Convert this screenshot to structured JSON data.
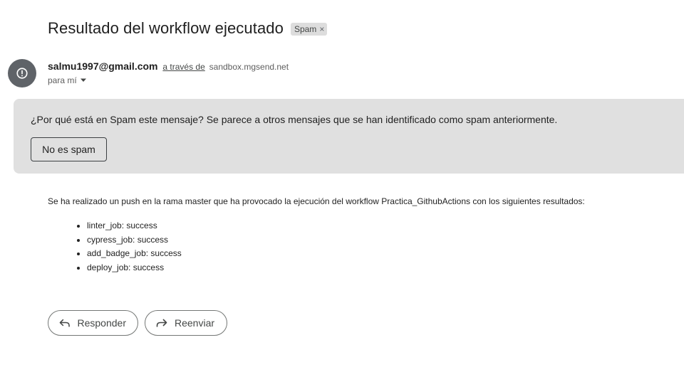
{
  "email": {
    "subject": "Resultado del workflow ejecutado",
    "label": "Spam",
    "label_close": "×",
    "sender_email": "salmu1997@gmail.com",
    "via_text": "a través de",
    "via_domain": "sandbox.mgsend.net",
    "to_text": "para mí",
    "avatar_icon": "alert-circle-icon"
  },
  "spam_banner": {
    "question": "¿Por qué está en Spam este mensaje?",
    "explanation": " Se parece a otros mensajes que se han identificado como spam anteriormente.",
    "not_spam_button": "No es spam",
    "background": "#e0e0e0"
  },
  "body": {
    "intro": "Se ha realizado un push en la rama master que ha provocado la ejecución del workflow Practica_GithubActions con los siguientes resultados:",
    "results": [
      "linter_job: success",
      "cypress_job: success",
      "add_badge_job: success",
      "deploy_job: success"
    ]
  },
  "actions": {
    "reply": "Responder",
    "forward": "Reenviar"
  }
}
